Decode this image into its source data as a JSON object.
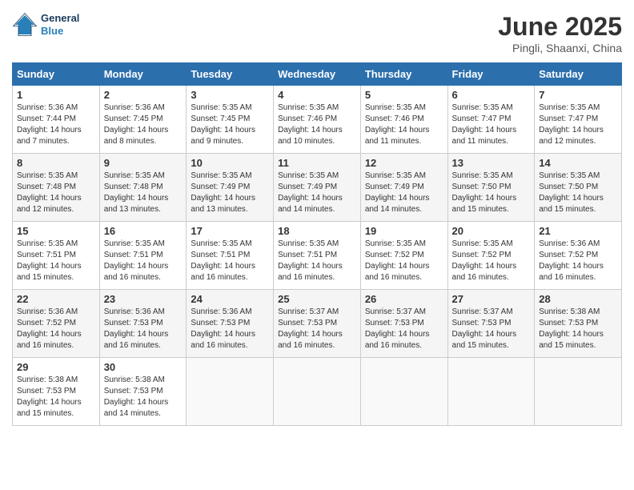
{
  "header": {
    "logo_line1": "General",
    "logo_line2": "Blue",
    "month_year": "June 2025",
    "location": "Pingli, Shaanxi, China"
  },
  "weekdays": [
    "Sunday",
    "Monday",
    "Tuesday",
    "Wednesday",
    "Thursday",
    "Friday",
    "Saturday"
  ],
  "weeks": [
    [
      {
        "day": "1",
        "sunrise": "5:36 AM",
        "sunset": "7:44 PM",
        "daylight": "14 hours and 7 minutes."
      },
      {
        "day": "2",
        "sunrise": "5:36 AM",
        "sunset": "7:45 PM",
        "daylight": "14 hours and 8 minutes."
      },
      {
        "day": "3",
        "sunrise": "5:35 AM",
        "sunset": "7:45 PM",
        "daylight": "14 hours and 9 minutes."
      },
      {
        "day": "4",
        "sunrise": "5:35 AM",
        "sunset": "7:46 PM",
        "daylight": "14 hours and 10 minutes."
      },
      {
        "day": "5",
        "sunrise": "5:35 AM",
        "sunset": "7:46 PM",
        "daylight": "14 hours and 11 minutes."
      },
      {
        "day": "6",
        "sunrise": "5:35 AM",
        "sunset": "7:47 PM",
        "daylight": "14 hours and 11 minutes."
      },
      {
        "day": "7",
        "sunrise": "5:35 AM",
        "sunset": "7:47 PM",
        "daylight": "14 hours and 12 minutes."
      }
    ],
    [
      {
        "day": "8",
        "sunrise": "5:35 AM",
        "sunset": "7:48 PM",
        "daylight": "14 hours and 12 minutes."
      },
      {
        "day": "9",
        "sunrise": "5:35 AM",
        "sunset": "7:48 PM",
        "daylight": "14 hours and 13 minutes."
      },
      {
        "day": "10",
        "sunrise": "5:35 AM",
        "sunset": "7:49 PM",
        "daylight": "14 hours and 13 minutes."
      },
      {
        "day": "11",
        "sunrise": "5:35 AM",
        "sunset": "7:49 PM",
        "daylight": "14 hours and 14 minutes."
      },
      {
        "day": "12",
        "sunrise": "5:35 AM",
        "sunset": "7:49 PM",
        "daylight": "14 hours and 14 minutes."
      },
      {
        "day": "13",
        "sunrise": "5:35 AM",
        "sunset": "7:50 PM",
        "daylight": "14 hours and 15 minutes."
      },
      {
        "day": "14",
        "sunrise": "5:35 AM",
        "sunset": "7:50 PM",
        "daylight": "14 hours and 15 minutes."
      }
    ],
    [
      {
        "day": "15",
        "sunrise": "5:35 AM",
        "sunset": "7:51 PM",
        "daylight": "14 hours and 15 minutes."
      },
      {
        "day": "16",
        "sunrise": "5:35 AM",
        "sunset": "7:51 PM",
        "daylight": "14 hours and 16 minutes."
      },
      {
        "day": "17",
        "sunrise": "5:35 AM",
        "sunset": "7:51 PM",
        "daylight": "14 hours and 16 minutes."
      },
      {
        "day": "18",
        "sunrise": "5:35 AM",
        "sunset": "7:51 PM",
        "daylight": "14 hours and 16 minutes."
      },
      {
        "day": "19",
        "sunrise": "5:35 AM",
        "sunset": "7:52 PM",
        "daylight": "14 hours and 16 minutes."
      },
      {
        "day": "20",
        "sunrise": "5:35 AM",
        "sunset": "7:52 PM",
        "daylight": "14 hours and 16 minutes."
      },
      {
        "day": "21",
        "sunrise": "5:36 AM",
        "sunset": "7:52 PM",
        "daylight": "14 hours and 16 minutes."
      }
    ],
    [
      {
        "day": "22",
        "sunrise": "5:36 AM",
        "sunset": "7:52 PM",
        "daylight": "14 hours and 16 minutes."
      },
      {
        "day": "23",
        "sunrise": "5:36 AM",
        "sunset": "7:53 PM",
        "daylight": "14 hours and 16 minutes."
      },
      {
        "day": "24",
        "sunrise": "5:36 AM",
        "sunset": "7:53 PM",
        "daylight": "14 hours and 16 minutes."
      },
      {
        "day": "25",
        "sunrise": "5:37 AM",
        "sunset": "7:53 PM",
        "daylight": "14 hours and 16 minutes."
      },
      {
        "day": "26",
        "sunrise": "5:37 AM",
        "sunset": "7:53 PM",
        "daylight": "14 hours and 16 minutes."
      },
      {
        "day": "27",
        "sunrise": "5:37 AM",
        "sunset": "7:53 PM",
        "daylight": "14 hours and 15 minutes."
      },
      {
        "day": "28",
        "sunrise": "5:38 AM",
        "sunset": "7:53 PM",
        "daylight": "14 hours and 15 minutes."
      }
    ],
    [
      {
        "day": "29",
        "sunrise": "5:38 AM",
        "sunset": "7:53 PM",
        "daylight": "14 hours and 15 minutes."
      },
      {
        "day": "30",
        "sunrise": "5:38 AM",
        "sunset": "7:53 PM",
        "daylight": "14 hours and 14 minutes."
      },
      null,
      null,
      null,
      null,
      null
    ]
  ]
}
